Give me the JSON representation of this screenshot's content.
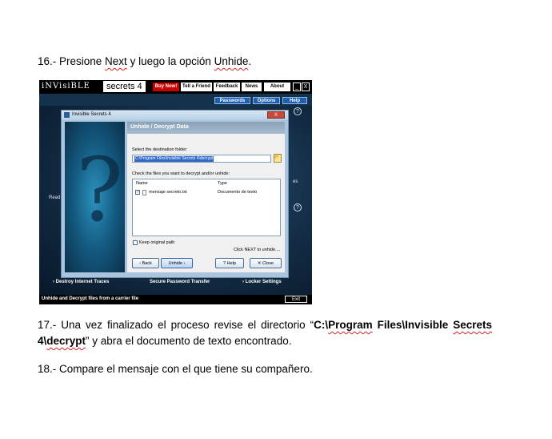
{
  "doc": {
    "step16": {
      "prefix": "16.- Presione ",
      "next_word": "Next",
      "middle": " y luego la opción ",
      "unhide_word": "Unhide",
      "suffix": "."
    },
    "step17": {
      "prefix": "17.- Una vez finalizado el proceso revise el directorio “",
      "path_part1": "C:\\",
      "path_program": "Program",
      "path_part2": " Files\\Invisible ",
      "path_secrets": "Secrets",
      "path_4": "4\\",
      "path_decrypt": "decrypt",
      "suffix": "” y abra el documento de texto encontrado."
    },
    "step18": "18.- Compare el mensaje con el que tiene su compañero."
  },
  "screenshot": {
    "logo_text": "iNVisiBLE",
    "logo_num": "secrets 4",
    "top_buttons": [
      "Buy Now!",
      "Tell a Friend",
      "Feedback",
      "News",
      "About"
    ],
    "window_controls": [
      "_",
      "X"
    ],
    "menu_buttons": [
      "Passwords",
      "Options",
      "Help"
    ],
    "help_glyph": "?",
    "side_left_text": "Read",
    "side_right_text": "es",
    "bottom_links": [
      "› Destroy Internet Traces",
      "Secure Password Transfer",
      "› Locker Settings"
    ],
    "status_text": "Unhide and Decrypt files from a carrier file",
    "exit_label": "Exit",
    "dialog": {
      "title": "Invisible Secrets 4",
      "close_label": "X",
      "question_glyph": "?",
      "header": "Unhide / Decrypt Data",
      "dest_label": "Select the destination folder:",
      "dest_value": "C:\\Program Files\\Invisible Secrets 4\\decrypt",
      "browse_glyph": "📂",
      "files_label": "Check the files you want to decrypt and/or unhide:",
      "col_name": "Name",
      "col_type": "Type",
      "file_name": "mensaje secreto.txt",
      "file_type": "Documento de texto",
      "file_checked": "✓",
      "keep_label": "Keep original path",
      "hint": "Click NEXT to unhide....",
      "buttons": [
        "‹ Back",
        "Unhide ›",
        "? Help",
        "✕ Close"
      ]
    }
  }
}
